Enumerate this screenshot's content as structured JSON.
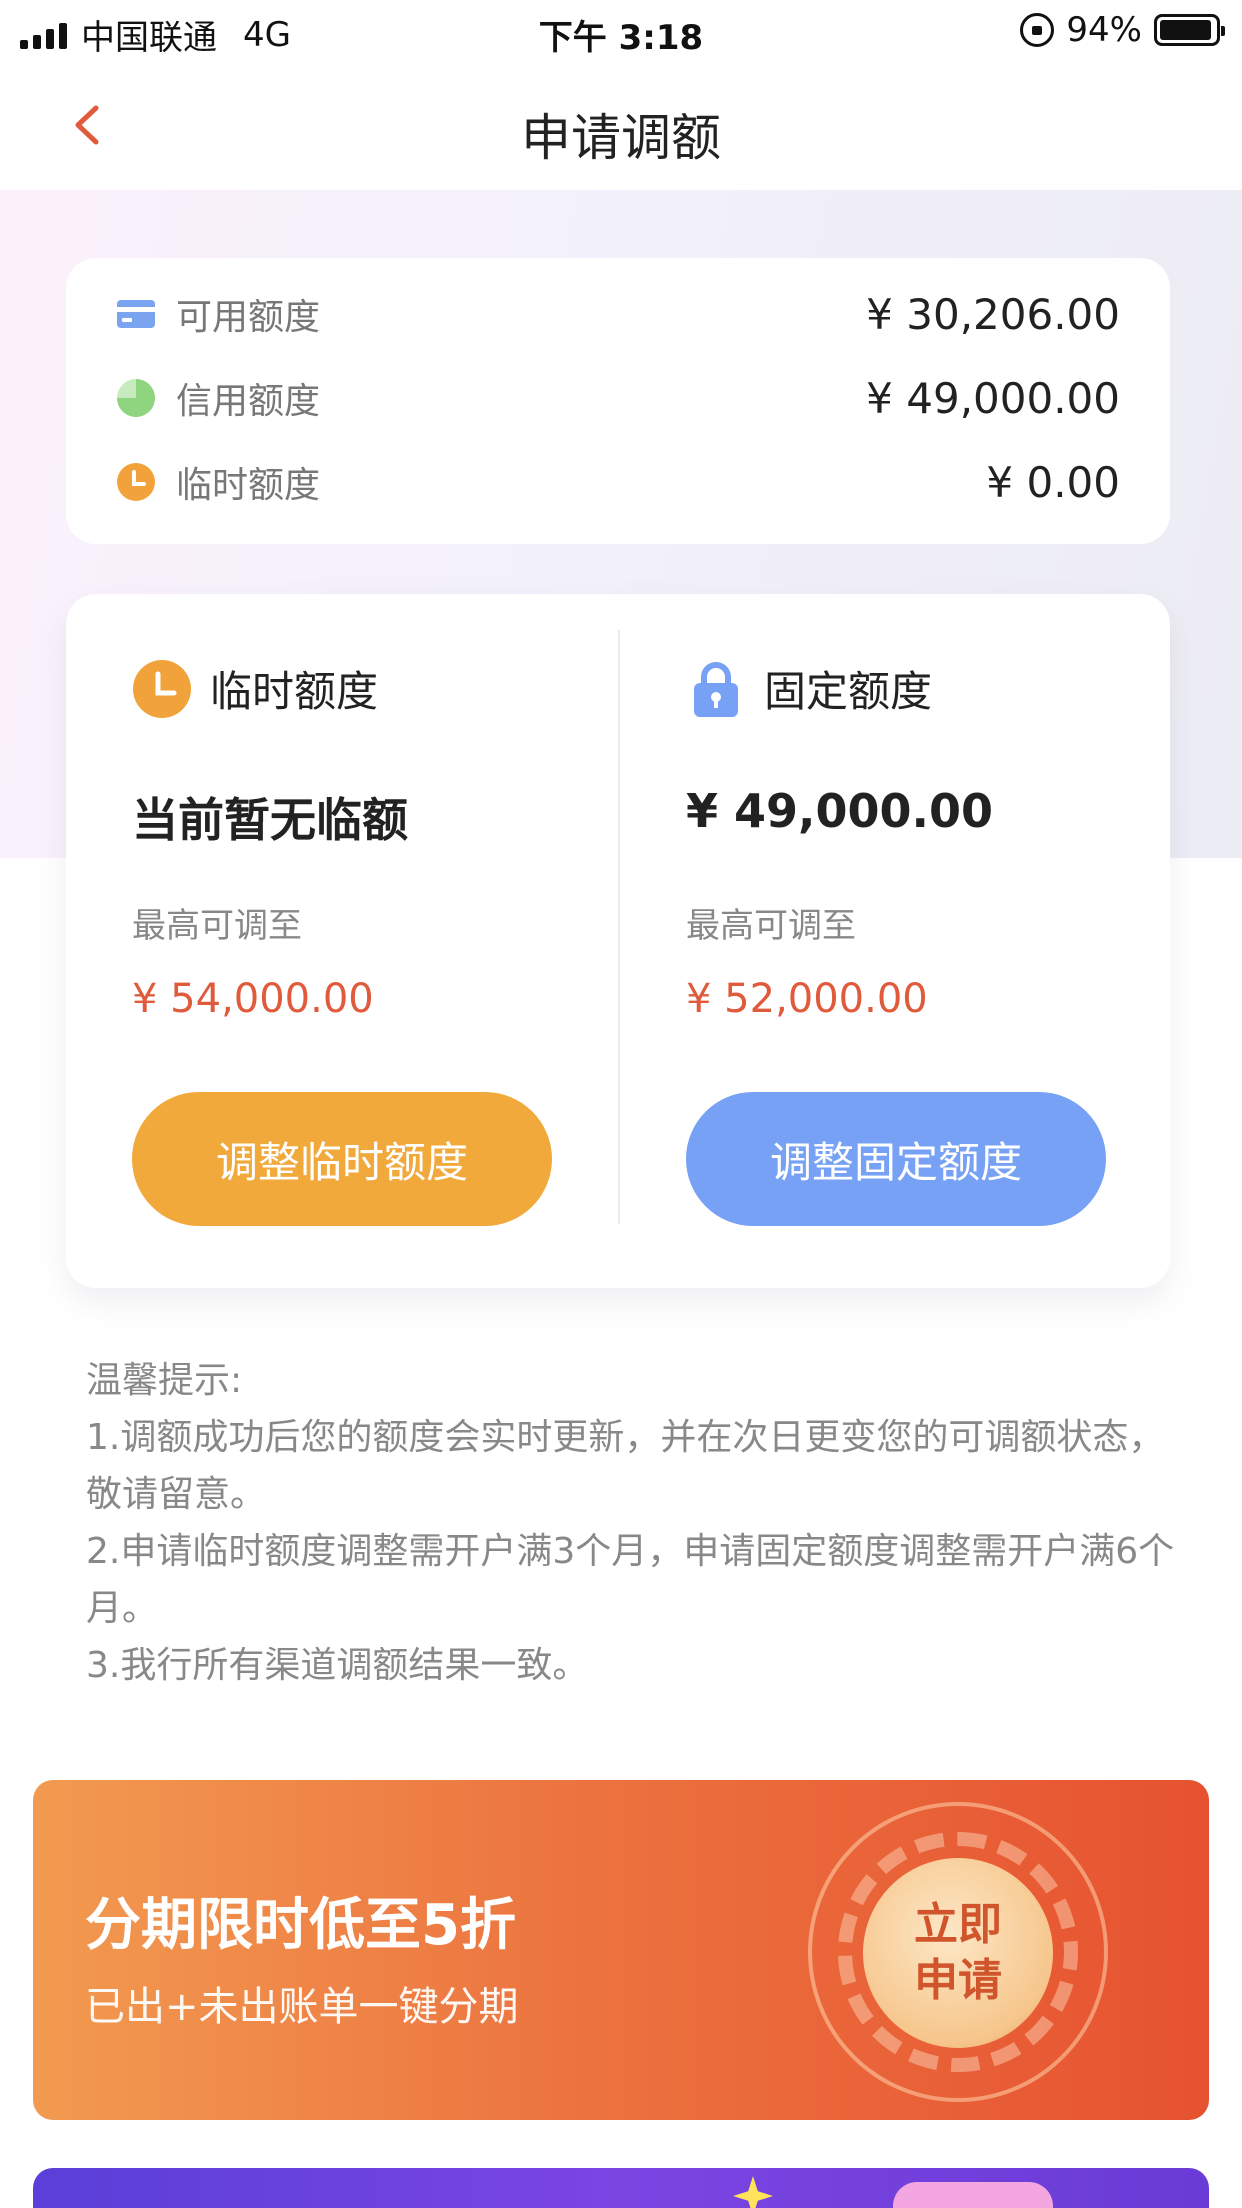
{
  "status_bar": {
    "carrier": "中国联通",
    "network": "4G",
    "time": "下午 3:18",
    "battery": "94%",
    "battery_level": 0.94
  },
  "nav": {
    "title": "申请调额",
    "back_icon": "chevron-left-icon"
  },
  "summary": {
    "rows": [
      {
        "label": "可用额度",
        "value": "¥ 30,206.00",
        "icon": "card-icon",
        "color": "#7aa4ef"
      },
      {
        "label": "信用额度",
        "value": "¥ 49,000.00",
        "icon": "pie-icon",
        "color": "#9bd98b"
      },
      {
        "label": "临时额度",
        "value": "¥ 0.00",
        "icon": "clock-icon",
        "color": "#f2a23a"
      }
    ]
  },
  "adjust": {
    "temporary": {
      "title": "临时额度",
      "icon": "clock-icon",
      "current": "当前暂无临额",
      "max_label": "最高可调至",
      "max_value": "¥ 54,000.00",
      "button": "调整临时额度"
    },
    "fixed": {
      "title": "固定额度",
      "icon": "lock-icon",
      "current": "¥ 49,000.00",
      "max_label": "最高可调至",
      "max_value": "¥ 52,000.00",
      "button": "调整固定额度"
    }
  },
  "tips": {
    "heading": "温馨提示:",
    "items": [
      "1.调额成功后您的额度会实时更新，并在次日更变您的可调额状态，敬请留意。",
      "2.申请临时额度调整需开户满3个月，申请固定额度调整需开户满6个月。",
      "3.我行所有渠道调额结果一致。"
    ]
  },
  "banner": {
    "title": "分期限时低至5折",
    "subtitle": "已出+未出账单一键分期",
    "cta": "立即申请"
  },
  "colors": {
    "accent_red": "#e05a3c",
    "orange": "#f2a93b",
    "blue": "#77a1f5"
  }
}
